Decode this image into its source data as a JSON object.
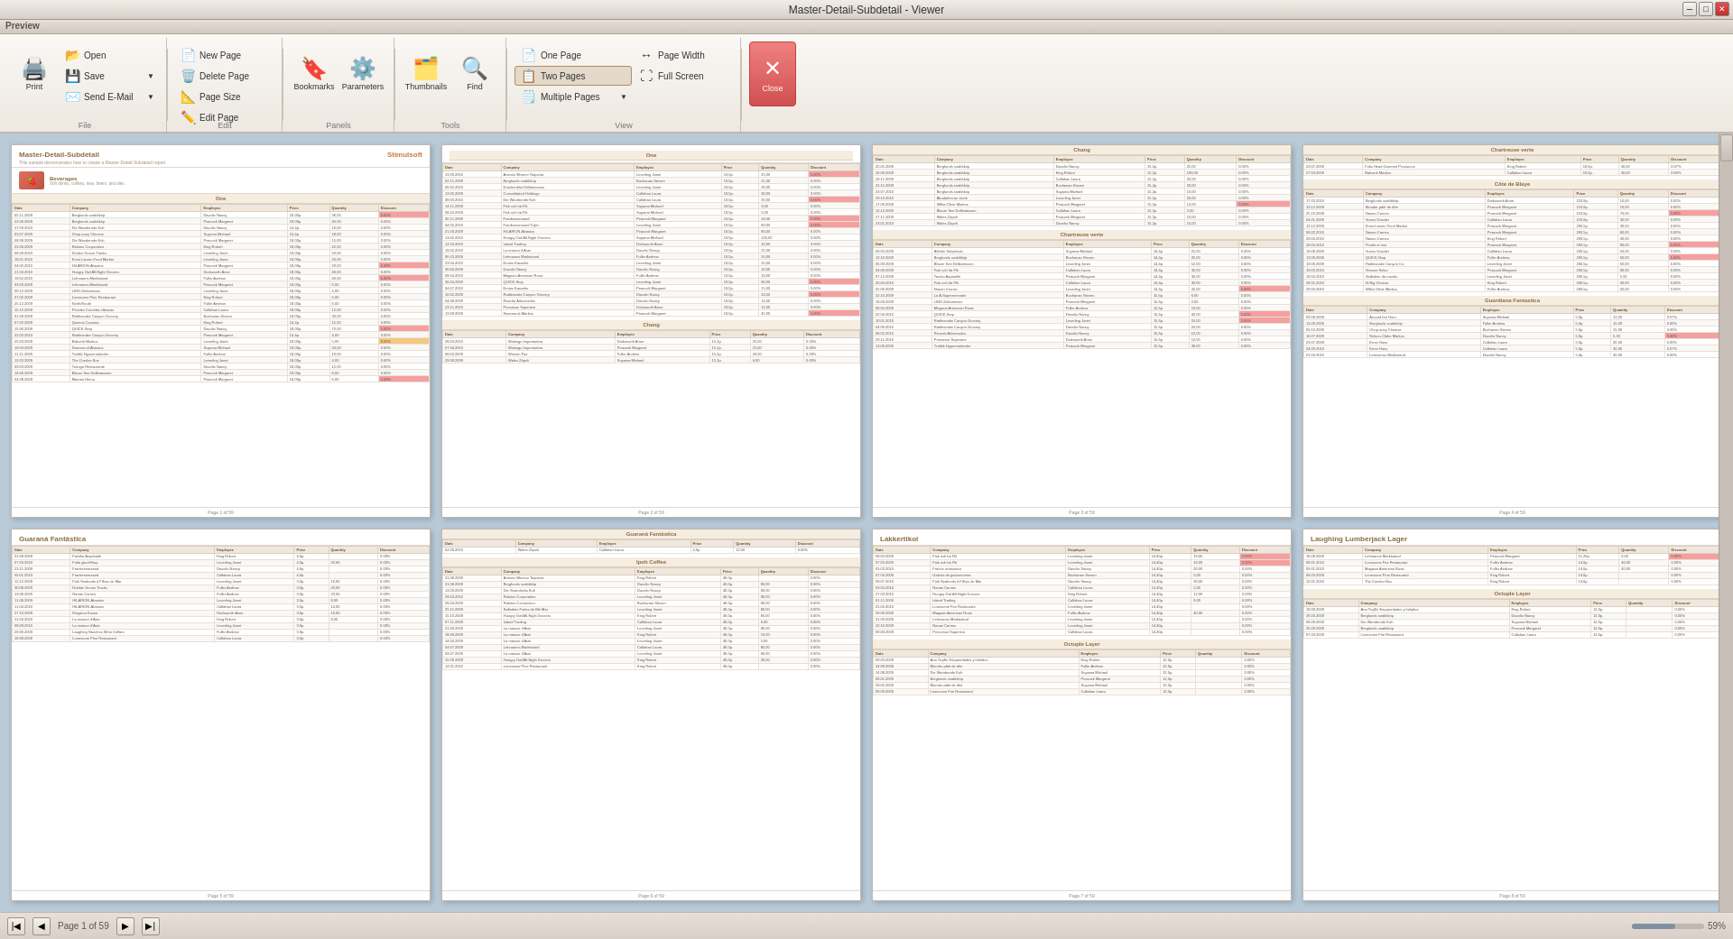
{
  "window": {
    "title": "Master-Detail-Subdetail - Viewer"
  },
  "preview_label": "Preview",
  "toolbar": {
    "file_group": {
      "label": "File",
      "print_label": "Print",
      "open_label": "Open",
      "save_label": "Save",
      "send_email_label": "Send E-Mail"
    },
    "edit_group": {
      "label": "Edit",
      "new_page_label": "New Page",
      "delete_page_label": "Delete Page",
      "page_size_label": "Page Size",
      "edit_page_label": "Edit Page"
    },
    "panels_group": {
      "label": "Panels",
      "bookmarks_label": "Bookmarks",
      "parameters_label": "Parameters"
    },
    "tools_group": {
      "label": "Tools",
      "thumbnails_label": "Thumbnails",
      "find_label": "Find"
    },
    "view_group": {
      "label": "View",
      "one_page_label": "One Page",
      "two_pages_label": "Two Pages",
      "multiple_pages_label": "Multiple Pages",
      "page_width_label": "Page Width",
      "full_screen_label": "Full Screen"
    },
    "close_label": "Close"
  },
  "pages": [
    {
      "number": "Page 1 of 59",
      "title": "Master-Detail-Subdetail",
      "brand": "Stimulsoft",
      "section": "One",
      "is_first": true
    },
    {
      "number": "Page 2 of 59",
      "title": "One",
      "section": "Chang",
      "is_first": false
    },
    {
      "number": "Page 3 of 59",
      "title": "Chang",
      "section": "Chartreuse verte",
      "is_first": false
    },
    {
      "number": "Page 4 of 59",
      "title": "Chartreuse verte",
      "section": "Côte de Blaye",
      "is_first": false
    },
    {
      "number": "Page 5 of 59",
      "title": "Guaraná Fantástica",
      "section": "",
      "is_first": false
    },
    {
      "number": "Page 6 of 59",
      "title": "Guaraná Fantástica",
      "section": "Ipoh Coffee",
      "is_first": false
    },
    {
      "number": "Page 7 of 59",
      "title": "Lakkertikol",
      "section": "",
      "is_first": false
    },
    {
      "number": "Page 8 of 59",
      "title": "Laughing Lumberjack Lager",
      "section": "",
      "is_first": false
    }
  ],
  "statusbar": {
    "page_label": "Page 1 of 59",
    "zoom_label": "59%"
  }
}
